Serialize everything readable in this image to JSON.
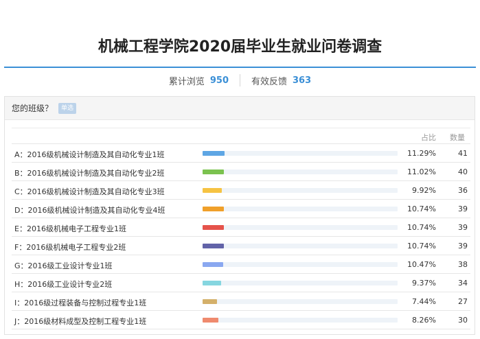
{
  "title": "机械工程学院2020届毕业生就业问卷调查",
  "stats": {
    "views_label": "累计浏览",
    "views_value": "950",
    "feedback_label": "有效反馈",
    "feedback_value": "363"
  },
  "question": {
    "text": "您的班级？",
    "type": "单选"
  },
  "table": {
    "col_ratio": "占比",
    "col_count": "数量",
    "rows": [
      {
        "label": "A：2016级机械设计制造及其自动化专业1班",
        "pct": "11.29%",
        "count": "41",
        "ratio": 0.1129,
        "color": "#5ea6e4"
      },
      {
        "label": "B：2016级机械设计制造及其自动化专业2班",
        "pct": "11.02%",
        "count": "40",
        "ratio": 0.1102,
        "color": "#7bc24f"
      },
      {
        "label": "C：2016级机械设计制造及其自动化专业3班",
        "pct": "9.92%",
        "count": "36",
        "ratio": 0.0992,
        "color": "#f6c343"
      },
      {
        "label": "D：2016级机械设计制造及其自动化专业4班",
        "pct": "10.74%",
        "count": "39",
        "ratio": 0.1074,
        "color": "#f0a02a"
      },
      {
        "label": "E：2016级机械电子工程专业1班",
        "pct": "10.74%",
        "count": "39",
        "ratio": 0.1074,
        "color": "#e5534b"
      },
      {
        "label": "F：2016级机械电子工程专业2班",
        "pct": "10.74%",
        "count": "39",
        "ratio": 0.1074,
        "color": "#6263a8"
      },
      {
        "label": "G：2016级工业设计专业1班",
        "pct": "10.47%",
        "count": "38",
        "ratio": 0.1047,
        "color": "#8aa8f0"
      },
      {
        "label": "H：2016级工业设计专业2班",
        "pct": "9.37%",
        "count": "34",
        "ratio": 0.0937,
        "color": "#86d6e0"
      },
      {
        "label": "I：2016级过程装备与控制过程专业1班",
        "pct": "7.44%",
        "count": "27",
        "ratio": 0.0744,
        "color": "#d4b06a"
      },
      {
        "label": "J：2016级材料成型及控制工程专业1班",
        "pct": "8.26%",
        "count": "30",
        "ratio": 0.0826,
        "color": "#ef8a6e"
      }
    ]
  }
}
